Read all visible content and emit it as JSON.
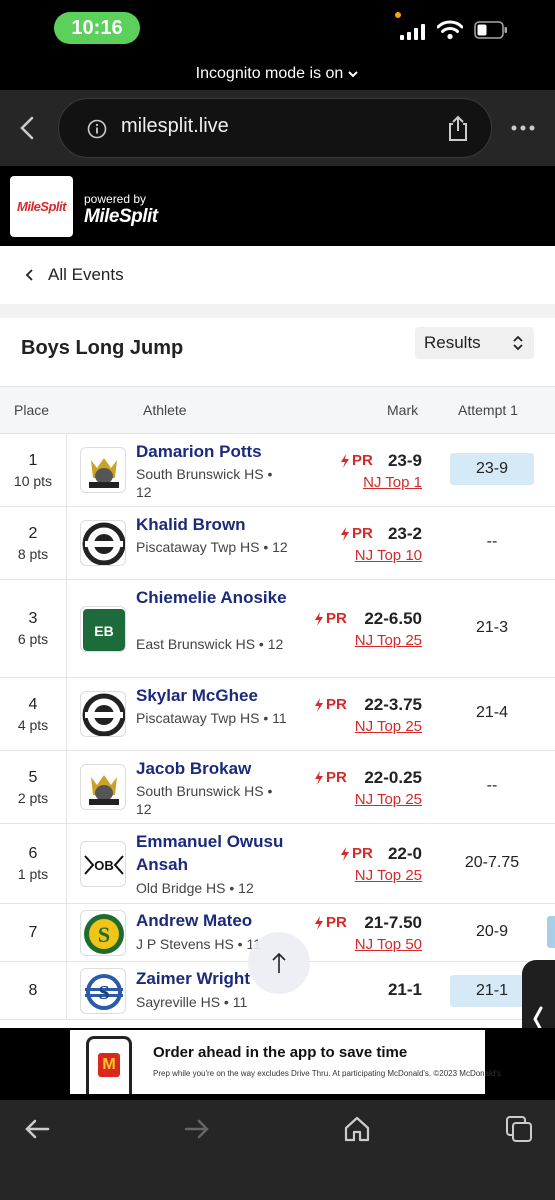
{
  "status_bar": {
    "time": "10:16"
  },
  "incognito": {
    "text": "Incognito mode is on"
  },
  "browser": {
    "url": "milesplit.live"
  },
  "header": {
    "logo_text": "MileSplit",
    "powered_by": "powered by",
    "brand": "MileSplit"
  },
  "nav": {
    "back_label": "All Events"
  },
  "event": {
    "title": "Boys Long Jump",
    "view_select": "Results"
  },
  "table": {
    "headers": {
      "place": "Place",
      "athlete": "Athlete",
      "mark": "Mark",
      "attempt": "Attempt 1"
    },
    "rows": [
      {
        "place": "1",
        "pts": "10 pts",
        "name": "Damarion Potts",
        "school": "South Brunswick HS • 12",
        "pr": "PR",
        "mark": "23-9",
        "rank": "NJ Top 1",
        "attempt": "23-9",
        "attempt_highlight": true,
        "logo": "viking-logo"
      },
      {
        "place": "2",
        "pts": "8 pts",
        "name": "Khalid Brown",
        "school": "Piscataway Twp HS • 12",
        "pr": "PR",
        "mark": "23-2",
        "rank": "NJ Top 10",
        "attempt": "--",
        "attempt_highlight": false,
        "logo": "piscataway-logo"
      },
      {
        "place": "3",
        "pts": "6 pts",
        "name": "Chiemelie Anosike",
        "school": "East Brunswick HS • 12",
        "pr": "PR",
        "mark": "22-6.50",
        "rank": "NJ Top 25",
        "attempt": "21-3",
        "attempt_highlight": false,
        "logo": "east-brunswick-logo"
      },
      {
        "place": "4",
        "pts": "4 pts",
        "name": "Skylar McGhee",
        "school": "Piscataway Twp HS • 11",
        "pr": "PR",
        "mark": "22-3.75",
        "rank": "NJ Top 25",
        "attempt": "21-4",
        "attempt_highlight": false,
        "logo": "piscataway-logo"
      },
      {
        "place": "5",
        "pts": "2 pts",
        "name": "Jacob Brokaw",
        "school": "South Brunswick HS • 12",
        "pr": "PR",
        "mark": "22-0.25",
        "rank": "NJ Top 25",
        "attempt": "--",
        "attempt_highlight": false,
        "logo": "viking-logo"
      },
      {
        "place": "6",
        "pts": "1 pts",
        "name": "Emmanuel Owusu Ansah",
        "school": "Old Bridge HS • 12",
        "pr": "PR",
        "mark": "22-0",
        "rank": "NJ Top 25",
        "attempt": "20-7.75",
        "attempt_highlight": false,
        "logo": "old-bridge-logo"
      },
      {
        "place": "7",
        "pts": "",
        "name": "Andrew Mateo",
        "school": "J P Stevens HS • 11",
        "pr": "PR",
        "mark": "21-7.50",
        "rank": "NJ Top 50",
        "attempt": "20-9",
        "attempt_highlight": false,
        "logo": "jp-stevens-logo"
      },
      {
        "place": "8",
        "pts": "",
        "name": "Zaimer Wright",
        "school": "Sayreville HS • 11",
        "pr": "",
        "mark": "21-1",
        "rank": "",
        "attempt": "21-1",
        "attempt_highlight": true,
        "logo": "sayreville-logo"
      }
    ]
  },
  "ad": {
    "title": "Order ahead in the app to save time",
    "subtitle": "Prep while you're on the way excludes Drive Thru. At participating McDonald's. ©2023 McDonald's",
    "logo_letter": "M"
  },
  "colors": {
    "pr_red": "#d42a2a",
    "name_blue": "#1b2a7a",
    "highlight": "#d6e9f6",
    "time_green": "#5bd05b"
  }
}
